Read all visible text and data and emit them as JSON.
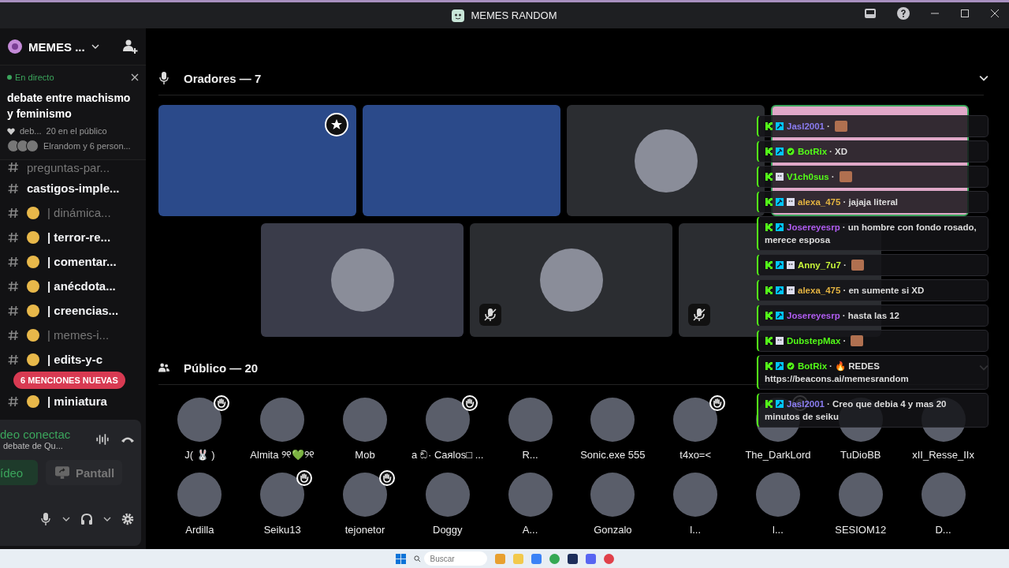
{
  "window": {
    "title": "MEMES RANDOM"
  },
  "server": {
    "name": "MEMES ..."
  },
  "live": {
    "status": "En directo",
    "title": "debate entre machismo y feminismo",
    "meta_stage": "deb...",
    "meta_audience": "20 en el público",
    "speakers_summary": "Elrandom y 6 person..."
  },
  "channels": [
    {
      "name": "preguntas-par...",
      "unread": false,
      "emoji": false
    },
    {
      "name": "castigos-imple...",
      "unread": true,
      "emoji": false
    },
    {
      "name": "| dinámica...",
      "unread": false,
      "emoji": true
    },
    {
      "name": "| terror-re...",
      "unread": true,
      "emoji": true
    },
    {
      "name": "| comentar...",
      "unread": true,
      "emoji": true
    },
    {
      "name": "| anécdota...",
      "unread": true,
      "emoji": true
    },
    {
      "name": "| creencias...",
      "unread": true,
      "emoji": true
    },
    {
      "name": "| memes-i...",
      "unread": false,
      "emoji": true
    },
    {
      "name": "| edits-y-c",
      "unread": true,
      "emoji": true
    },
    {
      "name": "| miniatura",
      "unread": true,
      "emoji": true
    }
  ],
  "mentions_badge": "6 MENCIONES NUEVAS",
  "voice": {
    "status": "deo conectac",
    "channel": "debate de Qu...",
    "video_button": "ídeo",
    "screen_button": "Pantall"
  },
  "stage": {
    "speakers_header": "Oradores — 7",
    "audience_header": "Público — 20"
  },
  "speakers": [
    {
      "kind": "video",
      "muted": false,
      "speaking": false,
      "moderator": true
    },
    {
      "kind": "video",
      "muted": false,
      "speaking": false,
      "moderator": false
    },
    {
      "kind": "avatar",
      "muted": false,
      "speaking": false,
      "moderator": false
    },
    {
      "kind": "video",
      "muted": false,
      "speaking": true,
      "moderator": false
    },
    {
      "kind": "avatar",
      "muted": false,
      "speaking": false,
      "moderator": false
    },
    {
      "kind": "avatar",
      "muted": true,
      "speaking": false,
      "moderator": false
    },
    {
      "kind": "avatar",
      "muted": true,
      "speaking": false,
      "moderator": false
    }
  ],
  "audience": [
    {
      "name": "J( 🐰 )",
      "hand": true
    },
    {
      "name": "Almita ୨୧💚୨୧",
      "hand": false
    },
    {
      "name": "Mob",
      "hand": false
    },
    {
      "name": "a ඞ· Caяlos□ ...",
      "hand": true
    },
    {
      "name": "R...",
      "hand": false
    },
    {
      "name": "Sonic.exe 555",
      "hand": false
    },
    {
      "name": "t4xo=<",
      "hand": true
    },
    {
      "name": "The_DarkLord",
      "hand": true
    },
    {
      "name": "TuDioBB",
      "hand": false
    },
    {
      "name": "xII_Resse_IIx",
      "hand": false
    },
    {
      "name": "Ardilla",
      "hand": false
    },
    {
      "name": "Seiku13",
      "hand": true
    },
    {
      "name": "tejonetor",
      "hand": true
    },
    {
      "name": "Doggy",
      "hand": false
    },
    {
      "name": "A...",
      "hand": false
    },
    {
      "name": "Gonzalo",
      "hand": false
    },
    {
      "name": "l...",
      "hand": false
    },
    {
      "name": "l...",
      "hand": false
    },
    {
      "name": "SESIOM12",
      "hand": false
    },
    {
      "name": "D...",
      "hand": false
    }
  ],
  "chat": [
    {
      "user": "Jasl2001",
      "color": "#8a7cf0",
      "badges": [
        {
          "kind": "kick"
        },
        {
          "kind": "mod"
        }
      ],
      "text": "·",
      "emote": true
    },
    {
      "user": "BotRix",
      "color": "#53fc18",
      "badges": [
        {
          "kind": "kick"
        },
        {
          "kind": "mod"
        },
        {
          "kind": "verified"
        }
      ],
      "text": "· XD",
      "emote": false
    },
    {
      "user": "V1ch0sus",
      "color": "#53fc18",
      "badges": [
        {
          "kind": "kick"
        },
        {
          "kind": "sub"
        }
      ],
      "text": "·",
      "emote": true
    },
    {
      "user": "alexa_475",
      "color": "#e3b341",
      "badges": [
        {
          "kind": "kick"
        },
        {
          "kind": "mod"
        },
        {
          "kind": "sub"
        }
      ],
      "text": "· jajaja literal",
      "emote": false
    },
    {
      "user": "Josereyesrp",
      "color": "#b05cf0",
      "badges": [
        {
          "kind": "kick"
        },
        {
          "kind": "mod"
        }
      ],
      "text": "· un hombre con fondo rosado,",
      "text_more": "merece esposa",
      "emote": false
    },
    {
      "user": "Anny_7u7",
      "color": "#c8f53a",
      "badges": [
        {
          "kind": "kick"
        },
        {
          "kind": "mod"
        },
        {
          "kind": "sub"
        }
      ],
      "text": "·",
      "emote": true
    },
    {
      "user": "alexa_475",
      "color": "#e3b341",
      "badges": [
        {
          "kind": "kick"
        },
        {
          "kind": "mod"
        },
        {
          "kind": "sub"
        }
      ],
      "text": "· en sumente si XD",
      "emote": false
    },
    {
      "user": "Josereyesrp",
      "color": "#b05cf0",
      "badges": [
        {
          "kind": "kick"
        },
        {
          "kind": "mod"
        }
      ],
      "text": "· hasta las 12",
      "emote": false
    },
    {
      "user": "DubstepMax",
      "color": "#53fc18",
      "badges": [
        {
          "kind": "kick"
        },
        {
          "kind": "sub"
        }
      ],
      "text": "·",
      "emote": true
    },
    {
      "user": "BotRix",
      "color": "#53fc18",
      "badges": [
        {
          "kind": "kick"
        },
        {
          "kind": "mod"
        },
        {
          "kind": "verified"
        }
      ],
      "text": "· 🔥 REDES",
      "text_more": "https://beacons.ai/memesrandom",
      "emote": false
    },
    {
      "user": "Jasl2001",
      "color": "#8a7cf0",
      "badges": [
        {
          "kind": "kick"
        },
        {
          "kind": "mod"
        }
      ],
      "text": "· Creo que debia 4 y mas 20",
      "text_more": "minutos de seiku",
      "emote": false
    }
  ],
  "taskbar": {
    "search_placeholder": "Buscar"
  }
}
